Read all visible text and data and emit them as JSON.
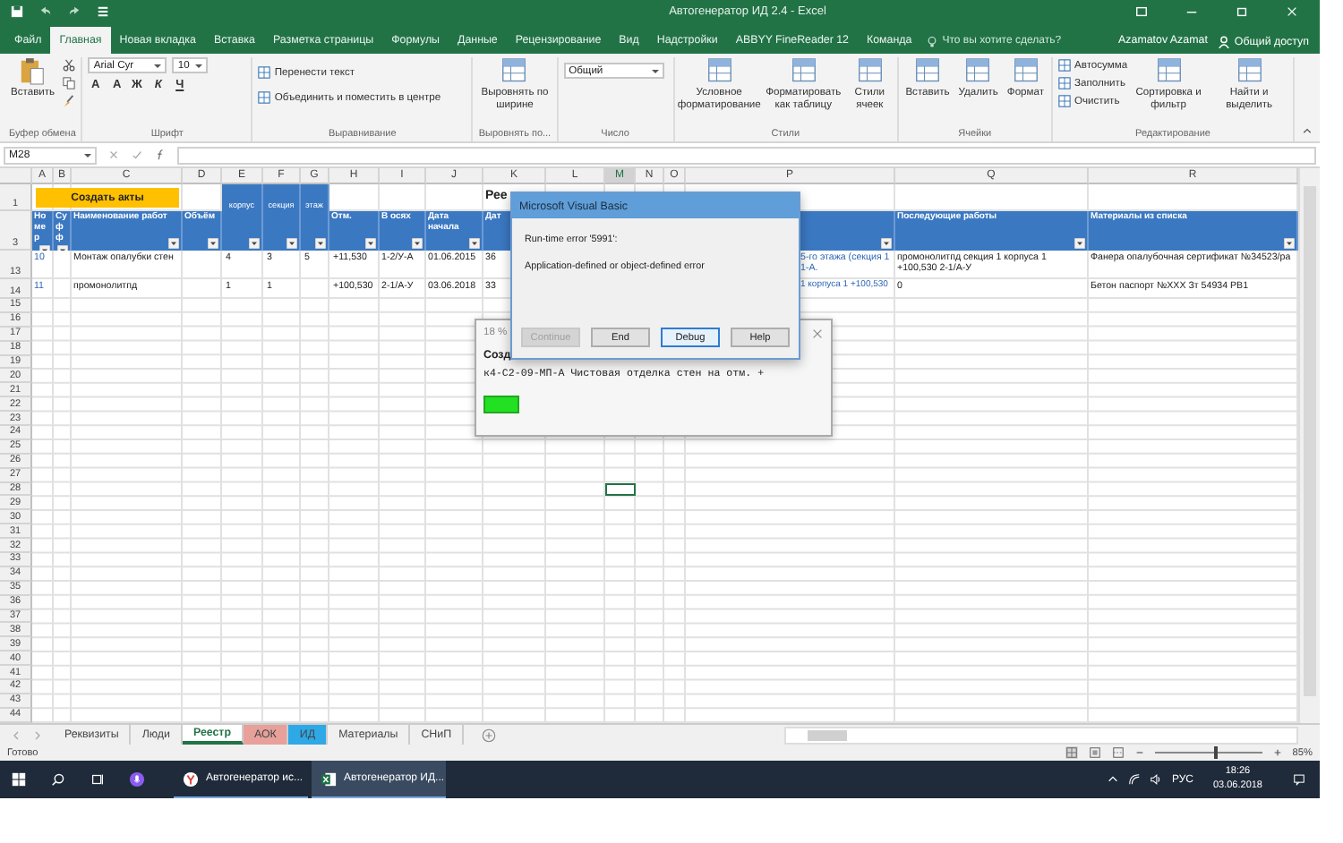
{
  "window": {
    "title": "Автогенератор ИД 2.4 - Excel"
  },
  "tabs": [
    {
      "label": "Файл",
      "selected": false
    },
    {
      "label": "Главная",
      "selected": true
    },
    {
      "label": "Новая вкладка",
      "selected": false
    },
    {
      "label": "Вставка",
      "selected": false
    },
    {
      "label": "Разметка страницы",
      "selected": false
    },
    {
      "label": "Формулы",
      "selected": false
    },
    {
      "label": "Данные",
      "selected": false
    },
    {
      "label": "Рецензирование",
      "selected": false
    },
    {
      "label": "Вид",
      "selected": false
    },
    {
      "label": "Надстройки",
      "selected": false
    },
    {
      "label": "ABBYY FineReader 12",
      "selected": false
    },
    {
      "label": "Команда",
      "selected": false
    }
  ],
  "tell_me": {
    "placeholder": "Что вы хотите сделать?"
  },
  "user": "Azamatov Azamat",
  "share": "Общий доступ",
  "ribbon": [
    {
      "label": "Буфер обмена",
      "items": [
        {
          "kind": "paste",
          "label": "Вставить"
        },
        {
          "kind": "tools"
        }
      ]
    },
    {
      "label": "Шрифт",
      "items": [
        {
          "kind": "combo",
          "value": "Arial Cyr"
        },
        {
          "kind": "combo",
          "value": "10"
        },
        {
          "kind": "glyphs",
          "values": [
            "A",
            "A"
          ]
        },
        {
          "kind": "glyphs",
          "values": [
            "Ж",
            "К",
            "Ч"
          ]
        }
      ]
    },
    {
      "label": "Выравнивание",
      "items": [
        {
          "kind": "small",
          "label": "Перенести текст"
        },
        {
          "kind": "small",
          "label": "Объединить и поместить в центре"
        }
      ]
    },
    {
      "label": "Выровнять по...",
      "items": [
        {
          "kind": "large",
          "label": "Выровнять по ширине"
        }
      ]
    },
    {
      "label": "Число",
      "items": [
        {
          "kind": "combo",
          "value": "Общий"
        }
      ]
    },
    {
      "label": "Стили",
      "items": [
        {
          "kind": "large",
          "label": "Условное форматирование"
        },
        {
          "kind": "large",
          "label": "Форматировать как таблицу"
        },
        {
          "kind": "large",
          "label": "Стили ячеек"
        }
      ]
    },
    {
      "label": "Ячейки",
      "items": [
        {
          "kind": "large",
          "label": "Вставить"
        },
        {
          "kind": "large",
          "label": "Удалить"
        },
        {
          "kind": "large",
          "label": "Формат"
        }
      ]
    },
    {
      "label": "Редактирование",
      "items": [
        {
          "kind": "small",
          "label": "Автосумма"
        },
        {
          "kind": "small",
          "label": "Заполнить"
        },
        {
          "kind": "small",
          "label": "Очистить"
        },
        {
          "kind": "large",
          "label": "Сортировка и фильтр"
        },
        {
          "kind": "large",
          "label": "Найти и выделить"
        }
      ]
    }
  ],
  "formula_bar": {
    "name_box": "M28"
  },
  "sheet": {
    "columns": [
      "A",
      "B",
      "C",
      "D",
      "E",
      "F",
      "G",
      "H",
      "I",
      "J",
      "K",
      "L",
      "M",
      "N",
      "O",
      "P",
      "Q",
      "R"
    ],
    "rows": [
      {
        "number": "1",
        "kind": "title",
        "cells": {
          "A": {
            "kind": "button",
            "text": "Создать акты"
          },
          "E": {
            "kind": "band",
            "text": "корпус"
          },
          "F": {
            "kind": "band",
            "text": "секция"
          },
          "G": {
            "kind": "band",
            "text": "этаж"
          },
          "K": {
            "kind": "title",
            "text": "Рее"
          }
        }
      },
      {
        "number": "3",
        "kind": "header",
        "cells": {
          "A": {
            "kind": "text",
            "text": "Номер"
          },
          "B": {
            "kind": "text",
            "text": "Суфф"
          },
          "C": {
            "kind": "text",
            "text": "Наименование работ"
          },
          "D": {
            "kind": "text",
            "text": "Объём"
          },
          "H": {
            "kind": "text",
            "text": "Отм."
          },
          "I": {
            "kind": "text",
            "text": "В осях"
          },
          "J": {
            "kind": "text",
            "text": "Дата начала"
          },
          "K": {
            "kind": "text",
            "text": "Дат"
          },
          "Q": {
            "kind": "text",
            "text": "Последующие работы"
          },
          "R": {
            "kind": "text",
            "text": "Материалы из списка"
          }
        }
      },
      {
        "number": "13",
        "kind": "data",
        "cells": {
          "A": {
            "kind": "link",
            "text": "10"
          },
          "C": {
            "kind": "text",
            "text": "Монтаж опалубки стен"
          },
          "E": {
            "kind": "text",
            "text": "4"
          },
          "F": {
            "kind": "text",
            "text": "3"
          },
          "G": {
            "kind": "text",
            "text": "5"
          },
          "H": {
            "kind": "text",
            "text": "+11,530"
          },
          "I": {
            "kind": "text",
            "text": "1-2/У-А"
          },
          "J": {
            "kind": "text",
            "text": "01.06.2015"
          },
          "K": {
            "kind": "text",
            "text": "36"
          },
          "P": {
            "kind": "link",
            "text": "5-го этажа (секция 1 1-А."
          },
          "Q": {
            "kind": "text",
            "text": "промонолитпд секция 1 корпуса 1 +100,530 2-1/А-У"
          },
          "R": {
            "kind": "text",
            "text": "Фанера опалубочная сертификат №34523/ра"
          }
        }
      },
      {
        "number": "14",
        "kind": "data",
        "cells": {
          "A": {
            "kind": "link",
            "text": "11"
          },
          "C": {
            "kind": "text",
            "text": "промонолитпд"
          },
          "E": {
            "kind": "text",
            "text": "1"
          },
          "F": {
            "kind": "text",
            "text": "1"
          },
          "H": {
            "kind": "text",
            "text": "+100,530"
          },
          "I": {
            "kind": "text",
            "text": "2-1/А-У"
          },
          "J": {
            "kind": "text",
            "text": "03.06.2018"
          },
          "K": {
            "kind": "text",
            "text": "33"
          },
          "P": {
            "kind": "link",
            "text": "1 корпуса 1 +100,530"
          },
          "Q": {
            "kind": "text",
            "text": "0"
          },
          "R": {
            "kind": "text",
            "text": "Бетон паспорт №XXX Зт 54934 РВ1"
          }
        }
      }
    ],
    "empty_rows": [
      "15",
      "16",
      "17",
      "18",
      "19",
      "20",
      "21",
      "22",
      "23",
      "24",
      "25",
      "26",
      "27",
      "28",
      "29",
      "30",
      "31",
      "32",
      "33",
      "34",
      "35",
      "36",
      "37",
      "38",
      "39",
      "40",
      "41",
      "42",
      "43",
      "44"
    ]
  },
  "progress_dialog": {
    "title": "18 %",
    "heading": "Созд",
    "line": "к4-С2-09-МП-А Чистовая отделка стен на отм. +"
  },
  "error_dialog": {
    "title": "Microsoft Visual Basic",
    "error": "Run-time error '5991':",
    "message": "Application-defined or object-defined error",
    "buttons": [
      {
        "label": "Continue",
        "disabled": true,
        "focused": false
      },
      {
        "label": "End",
        "disabled": false,
        "focused": false
      },
      {
        "label": "Debug",
        "disabled": false,
        "focused": true
      },
      {
        "label": "Help",
        "disabled": false,
        "focused": false
      }
    ]
  },
  "sheet_tabs": [
    {
      "label": "Реквизиты",
      "selected": false
    },
    {
      "label": "Люди",
      "selected": false
    },
    {
      "label": "Реестр",
      "selected": true
    },
    {
      "label": "АОК",
      "selected": false,
      "color": "#e8a09a"
    },
    {
      "label": "ИД",
      "selected": false,
      "color": "#2ea8e6"
    },
    {
      "label": "Материалы",
      "selected": false
    },
    {
      "label": "СНиП",
      "selected": false
    }
  ],
  "status": {
    "text": "Готово",
    "zoom": "85%",
    "zoom_slider": {
      "level": 0.55
    }
  },
  "taskbar": {
    "apps": [
      {
        "label": "Автогенератор ис...",
        "selected": false
      },
      {
        "label": "Автогенератор ИД...",
        "selected": true
      }
    ],
    "language": "РУС",
    "time": "18:26",
    "date": "03.06.2018"
  }
}
